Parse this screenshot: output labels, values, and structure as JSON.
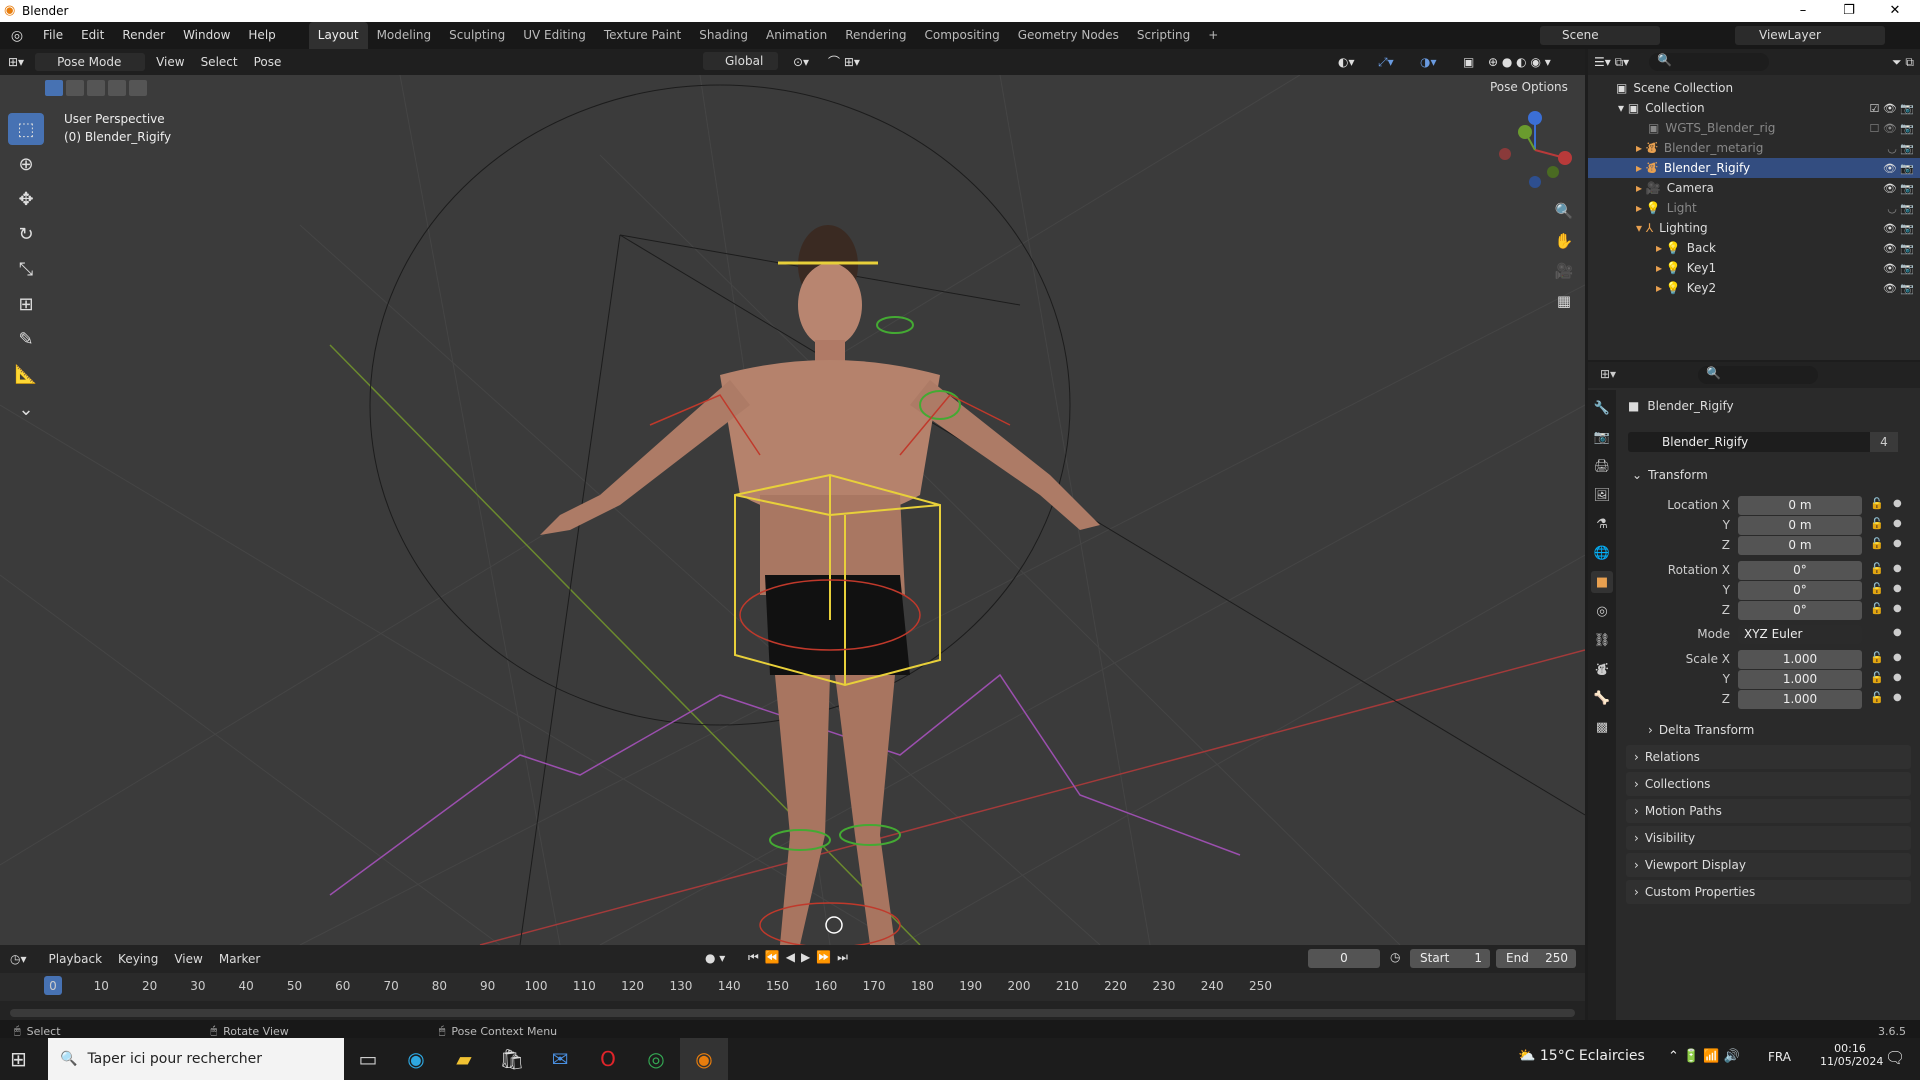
{
  "window": {
    "title": "Blender",
    "min": "–",
    "max": "❐",
    "close": "✕"
  },
  "menus": [
    "File",
    "Edit",
    "Render",
    "Window",
    "Help"
  ],
  "workspaces": [
    "Layout",
    "Modeling",
    "Sculpting",
    "UV Editing",
    "Texture Paint",
    "Shading",
    "Animation",
    "Rendering",
    "Compositing",
    "Geometry Nodes",
    "Scripting",
    "+"
  ],
  "scene": {
    "name": "Scene",
    "viewlayer": "ViewLayer"
  },
  "viewport_header": {
    "mode": "Pose Mode",
    "items": [
      "View",
      "Select",
      "Pose"
    ],
    "orientation": "Global",
    "pose_options": "Pose Options"
  },
  "viewport_info": {
    "perspective": "User Perspective",
    "object": "(0) Blender_Rigify"
  },
  "outliner": {
    "rows": [
      {
        "label": "Scene Collection",
        "state": "normal"
      },
      {
        "label": "Collection",
        "state": "normal"
      },
      {
        "label": "WGTS_Blender_rig",
        "state": "dim"
      },
      {
        "label": "Blender_metarig",
        "state": "dim"
      },
      {
        "label": "Blender_Rigify",
        "state": "sel"
      },
      {
        "label": "Camera",
        "state": "normal"
      },
      {
        "label": "Light",
        "state": "dim"
      },
      {
        "label": "Lighting",
        "state": "normal"
      },
      {
        "label": "Back",
        "state": "normal"
      },
      {
        "label": "Key1",
        "state": "normal"
      },
      {
        "label": "Key2",
        "state": "normal"
      }
    ]
  },
  "properties": {
    "object_name": "Blender_Rigify",
    "data_name": "Blender_Rigify",
    "users": "4",
    "transform_label": "Transform",
    "location": {
      "label": "Location X",
      "x": "0 m",
      "y": "0 m",
      "z": "0 m"
    },
    "rotation": {
      "label": "Rotation X",
      "x": "0°",
      "y": "0°",
      "z": "0°"
    },
    "mode": {
      "label": "Mode",
      "value": "XYZ Euler"
    },
    "scale": {
      "label": "Scale X",
      "x": "1.000",
      "y": "1.000",
      "z": "1.000"
    },
    "axis": {
      "y": "Y",
      "z": "Z"
    },
    "sections": [
      "Delta Transform",
      "Relations",
      "Collections",
      "Motion Paths",
      "Visibility",
      "Viewport Display",
      "Custom Properties"
    ]
  },
  "timeline": {
    "menus": [
      "Playback",
      "Keying",
      "View",
      "Marker"
    ],
    "current_frame": "0",
    "start_label": "Start",
    "start": "1",
    "end_label": "End",
    "end": "250",
    "ticks": [
      "0",
      "10",
      "20",
      "30",
      "40",
      "50",
      "60",
      "70",
      "80",
      "90",
      "100",
      "110",
      "120",
      "130",
      "140",
      "150",
      "160",
      "170",
      "180",
      "190",
      "200",
      "210",
      "220",
      "230",
      "240",
      "250"
    ]
  },
  "status": {
    "select": "Select",
    "rotate": "Rotate View",
    "context": "Pose Context Menu",
    "version": "3.6.5"
  },
  "taskbar": {
    "search": "Taper ici pour rechercher",
    "weather": "15°C  Eclaircies",
    "lang": "FRA",
    "time": "00:16",
    "date": "11/05/2024"
  }
}
